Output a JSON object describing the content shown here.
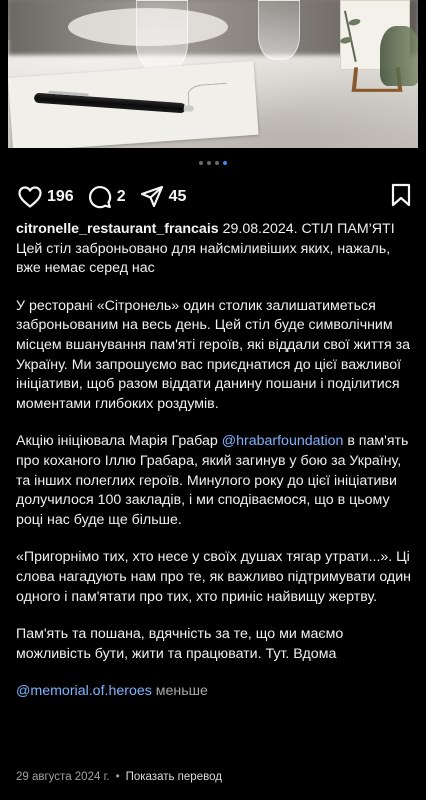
{
  "post": {
    "pager": {
      "total": 4,
      "active_index": 3
    },
    "actions": {
      "likes": "196",
      "comments": "2",
      "shares": "45"
    },
    "caption": {
      "username": "citronelle_restaurant_francais",
      "date_inline": "29.08.2024.",
      "title_line": "СТІЛ ПАМ’ЯТІ",
      "lead": "Цей стіл заброньовано для найсміливіших яких, нажаль, вже немає серед нас",
      "paragraph_1": "У ресторані «Сітронель» один столик залишатиметься заброньованим на весь день.  Цей стіл буде символічним місцем вшанування пам'яті героїв, які віддали свої життя за Україну. Ми запрошуємо вас приєднатися до цієї важливої ініціативи, щоб разом віддати данину пошани і поділитися моментами глибоких роздумів.",
      "paragraph_2_before": "Акцію ініціювала Марія Грабар ",
      "paragraph_2_mention": "@hrabarfoundation",
      "paragraph_2_after": " в пам'ять про коханого Іллю Грабара, який загинув у бою за Україну, та інших полеглих героїв. Минулого року до цієї ініціативи долучилося 100 закладів, і ми сподіваємося, що в цьому році нас буде ще більше.",
      "paragraph_3": " «Пригорнімо тих, хто несе у своїх душах тягар утрати...». Ці слова нагадують нам про те, як важливо підтримувати один одного і пам'ятати про тих, хто приніс найвищу жертву.",
      "paragraph_4": "Пам'ять та пошана, вдячність за те, що ми маємо можливість бути, жити та працювати. Тут. Вдома",
      "footer_mention": "@memorial.of.heroes",
      "less_label": " меньше"
    },
    "meta": {
      "date": "29 августа 2024 г.",
      "separator": "•",
      "translate_label": "Показать перевод"
    }
  },
  "icons": {
    "like": "heart-icon",
    "comment": "comment-bubble-icon",
    "share": "paper-plane-icon",
    "save": "bookmark-icon"
  },
  "colors": {
    "background": "#000000",
    "text": "#f0f0f0",
    "link": "#7fb2ff",
    "active_dot": "#3d8bf0",
    "muted": "#a0a0a0"
  }
}
